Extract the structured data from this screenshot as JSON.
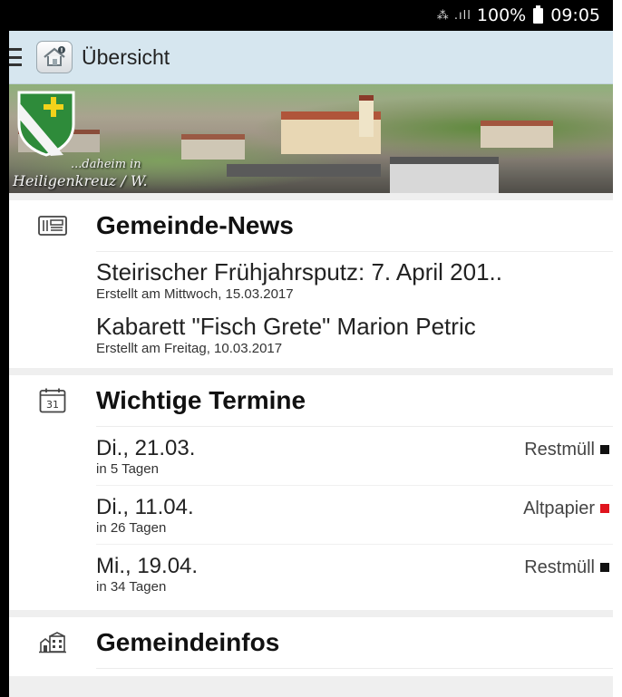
{
  "status_bar": {
    "signal": "⁂ .ıll",
    "battery": "100%",
    "time": "09:05"
  },
  "app_bar": {
    "title": "Übersicht"
  },
  "banner": {
    "caption_line1": "...daheim in",
    "caption_line2": "Heiligenkreuz / W."
  },
  "news": {
    "title": "Gemeinde-News",
    "items": [
      {
        "title": "Steirischer Frühjahrsputz: 7. April 201..",
        "subtitle": "Erstellt am Mittwoch, 15.03.2017"
      },
      {
        "title": "Kabarett \"Fisch Grete\" Marion Petric",
        "subtitle": "Erstellt am Freitag, 10.03.2017"
      }
    ]
  },
  "termine": {
    "title": "Wichtige Termine",
    "calendar_day": "31",
    "items": [
      {
        "date": "Di., 21.03.",
        "relative": "in 5 Tagen",
        "type": "Restmüll",
        "color": "#111111"
      },
      {
        "date": "Di., 11.04.",
        "relative": "in 26 Tagen",
        "type": "Altpapier",
        "color": "#e0141e"
      },
      {
        "date": "Mi., 19.04.",
        "relative": "in 34 Tagen",
        "type": "Restmüll",
        "color": "#111111"
      }
    ]
  },
  "infos": {
    "title": "Gemeindeinfos"
  },
  "icons": {
    "menu": "menu-icon",
    "home": "home-icon",
    "news": "newspaper-icon",
    "calendar": "calendar-icon",
    "infos": "town-hall-icon",
    "crest": "coat-of-arms-icon"
  }
}
